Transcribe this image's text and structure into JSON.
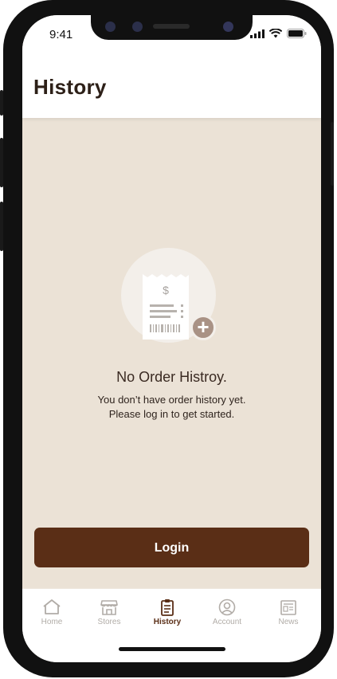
{
  "status_bar": {
    "time": "9:41"
  },
  "header": {
    "title": "History"
  },
  "empty_state": {
    "icon": "receipt-add-icon",
    "title": "No Order Histroy.",
    "message_line1": "You don’t have order history yet.",
    "message_line2": "Please log in to get started."
  },
  "login_button": {
    "label": "Login"
  },
  "tab_bar": {
    "tabs": [
      {
        "label": "Home",
        "icon": "home-icon",
        "active": false
      },
      {
        "label": "Stores",
        "icon": "store-icon",
        "active": false
      },
      {
        "label": "History",
        "icon": "clipboard-icon",
        "active": true
      },
      {
        "label": "Account",
        "icon": "account-icon",
        "active": false
      },
      {
        "label": "News",
        "icon": "newspaper-icon",
        "active": false
      }
    ]
  },
  "colors": {
    "background": "#ebe2d6",
    "accent": "#5a2e16",
    "inactive_tab": "#b1aca7"
  }
}
